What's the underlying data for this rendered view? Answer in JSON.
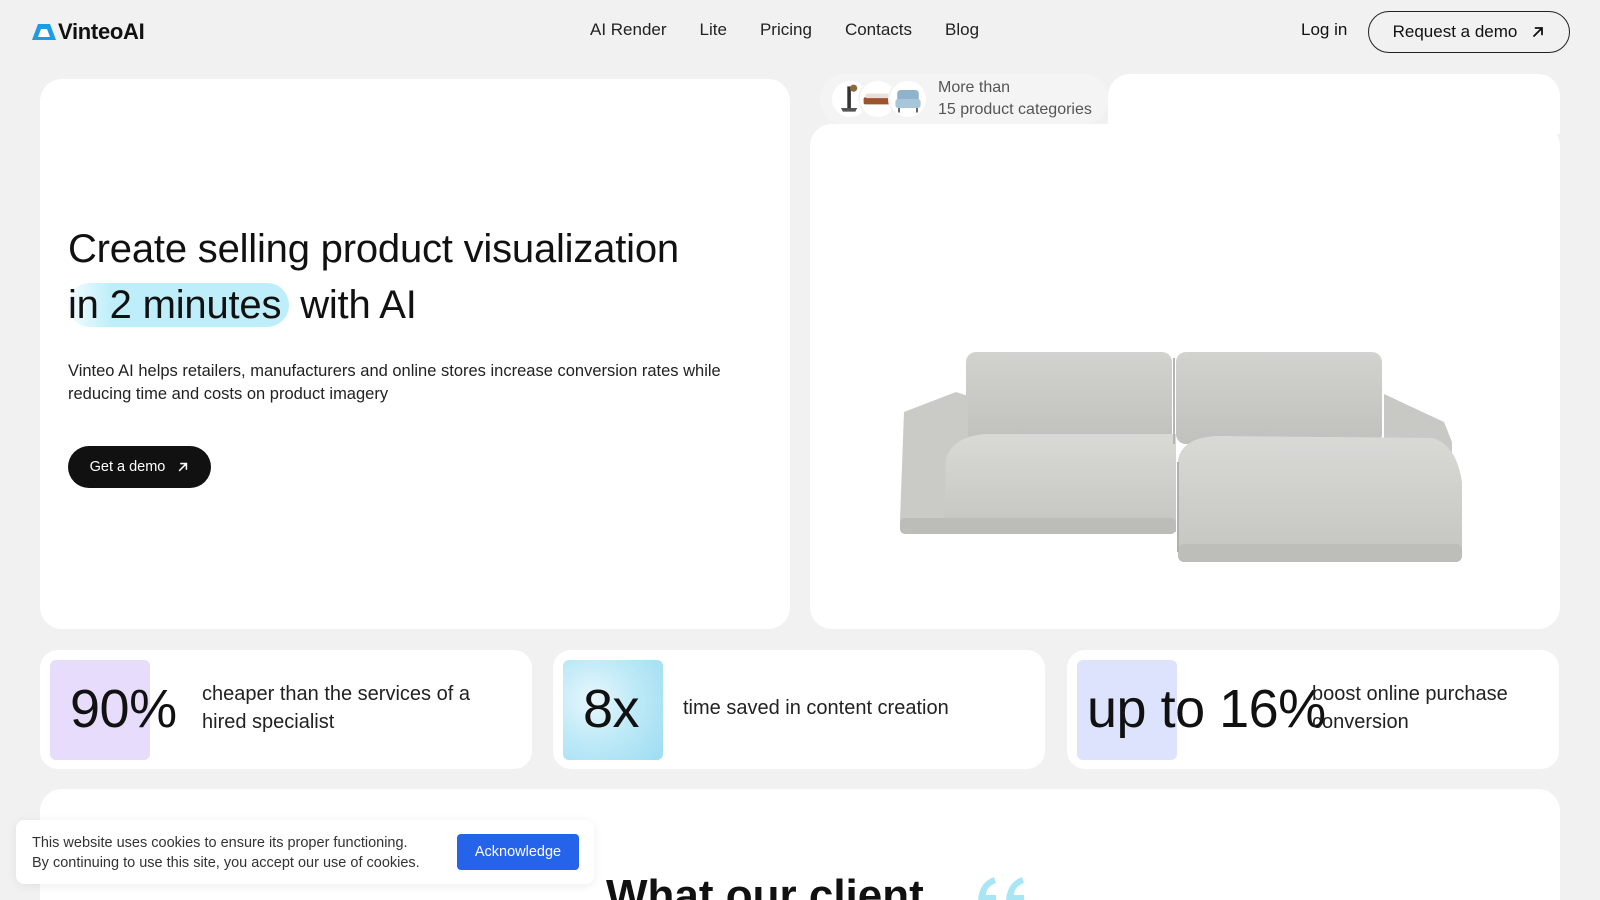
{
  "brand": {
    "name": "VinteoAI",
    "logo_color": "#1e9be6"
  },
  "nav": {
    "items": [
      {
        "label": "AI Render"
      },
      {
        "label": "Lite"
      },
      {
        "label": "Pricing"
      },
      {
        "label": "Contacts"
      },
      {
        "label": "Blog"
      }
    ],
    "login_label": "Log in",
    "request_demo_label": "Request a demo"
  },
  "hero": {
    "title_line1": "Create selling product visualization",
    "title_highlight": "in 2 minutes",
    "title_rest": "with AI",
    "description": "Vinteo AI helps retailers, manufacturers and online stores increase conversion rates while reducing time and costs on product imagery",
    "cta_label": "Get a demo",
    "categories_line1": "More than",
    "categories_line2": "15 product categories"
  },
  "stats": [
    {
      "value": "90%",
      "description": "cheaper than the services of a hired specialist",
      "tile_color": "#e7dcfb"
    },
    {
      "value": "8x",
      "description": "time saved in content creation",
      "tile_color": "#bfeaf7"
    },
    {
      "value": "up to 16%",
      "description": "boost online purchase conversion",
      "tile_color": "#dde3fd"
    }
  ],
  "lower": {
    "heading_partial": "What our client"
  },
  "cookie": {
    "line1": "This website uses cookies to ensure its proper functioning.",
    "line2": "By continuing to use this site, you accept our use of cookies.",
    "button_label": "Acknowledge",
    "button_color": "#2563eb"
  }
}
